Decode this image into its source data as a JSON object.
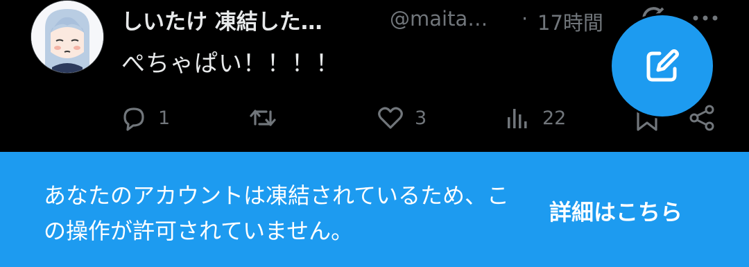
{
  "tweet": {
    "display_name": "しいたけ 凍結した…",
    "handle": "@maita…",
    "separator": "·",
    "time": "17時間",
    "text": "ぺちゃぱい！！！！",
    "replies": "1",
    "retweets": "",
    "likes": "3",
    "views": "22"
  },
  "banner": {
    "message": "あなたのアカウントは凍結されているため、この操作が許可されていません。",
    "link": "詳細はこちら"
  },
  "colors": {
    "background": "#000000",
    "accent": "#1d9bf0",
    "muted": "#71767b",
    "text": "#e7e9ea"
  },
  "icons": [
    "avatar",
    "grok-icon",
    "more-icon",
    "reply-icon",
    "retweet-icon",
    "like-icon",
    "views-icon",
    "bookmark-icon",
    "share-icon",
    "compose-icon"
  ]
}
